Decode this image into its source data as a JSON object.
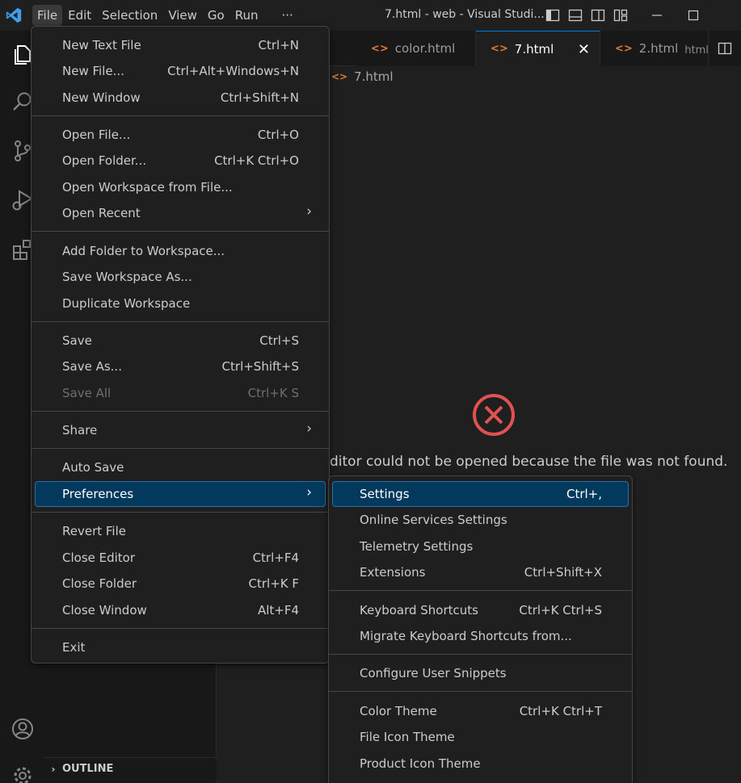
{
  "titlebar": {
    "menus": [
      "File",
      "Edit",
      "Selection",
      "View",
      "Go",
      "Run",
      "···"
    ],
    "window_title": "7.html - web - Visual Studi..."
  },
  "tabs": [
    {
      "label": "color.html",
      "icon": "<>",
      "description": ""
    },
    {
      "label": "7.html",
      "icon": "<>",
      "description": "",
      "close": "✕"
    },
    {
      "label": "2.html",
      "icon": "<>",
      "description": "html정"
    }
  ],
  "breadcrumb": {
    "icon": "<>",
    "file": "7.html"
  },
  "editor": {
    "error_message": "editor could not be opened because the file was not found.",
    "error_message_visible": "ditor could not be opened because the file was not found."
  },
  "sidebar": {
    "outline_label": "OUTLINE",
    "outline_chevron": "›"
  },
  "file_menu": {
    "items": [
      {
        "label": "New Text File",
        "shortcut": "Ctrl+N"
      },
      {
        "label": "New File...",
        "shortcut": "Ctrl+Alt+Windows+N"
      },
      {
        "label": "New Window",
        "shortcut": "Ctrl+Shift+N"
      },
      {
        "label": "Open File...",
        "shortcut": "Ctrl+O"
      },
      {
        "label": "Open Folder...",
        "shortcut": "Ctrl+K Ctrl+O"
      },
      {
        "label": "Open Workspace from File...",
        "shortcut": ""
      },
      {
        "label": "Open Recent",
        "shortcut": "",
        "submenu": "›"
      },
      {
        "label": "Add Folder to Workspace...",
        "shortcut": ""
      },
      {
        "label": "Save Workspace As...",
        "shortcut": ""
      },
      {
        "label": "Duplicate Workspace",
        "shortcut": ""
      },
      {
        "label": "Save",
        "shortcut": "Ctrl+S"
      },
      {
        "label": "Save As...",
        "shortcut": "Ctrl+Shift+S"
      },
      {
        "label": "Save All",
        "shortcut": "Ctrl+K S",
        "disabled": true
      },
      {
        "label": "Share",
        "shortcut": "",
        "submenu": "›"
      },
      {
        "label": "Auto Save",
        "shortcut": ""
      },
      {
        "label": "Preferences",
        "shortcut": "",
        "submenu": "›",
        "highlighted": true
      },
      {
        "label": "Revert File",
        "shortcut": ""
      },
      {
        "label": "Close Editor",
        "shortcut": "Ctrl+F4"
      },
      {
        "label": "Close Folder",
        "shortcut": "Ctrl+K F"
      },
      {
        "label": "Close Window",
        "shortcut": "Alt+F4"
      },
      {
        "label": "Exit",
        "shortcut": ""
      }
    ]
  },
  "preferences_menu": {
    "items": [
      {
        "label": "Settings",
        "shortcut": "Ctrl+,",
        "highlighted": true
      },
      {
        "label": "Online Services Settings",
        "shortcut": ""
      },
      {
        "label": "Telemetry Settings",
        "shortcut": ""
      },
      {
        "label": "Extensions",
        "shortcut": "Ctrl+Shift+X"
      },
      {
        "label": "Keyboard Shortcuts",
        "shortcut": "Ctrl+K Ctrl+S"
      },
      {
        "label": "Migrate Keyboard Shortcuts from...",
        "shortcut": ""
      },
      {
        "label": "Configure User Snippets",
        "shortcut": ""
      },
      {
        "label": "Color Theme",
        "shortcut": "Ctrl+K Ctrl+T"
      },
      {
        "label": "File Icon Theme",
        "shortcut": ""
      },
      {
        "label": "Product Icon Theme",
        "shortcut": ""
      }
    ]
  },
  "colors": {
    "accent": "#0078d4",
    "highlight": "#04395e",
    "error": "#e05252",
    "html_icon": "#e37933"
  }
}
